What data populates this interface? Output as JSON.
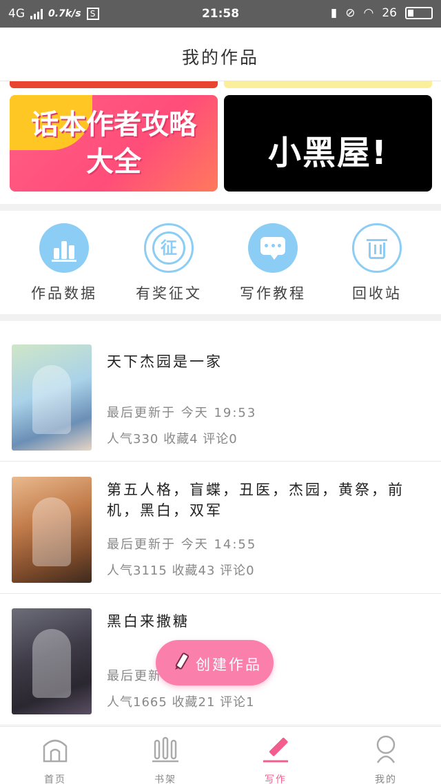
{
  "status_bar": {
    "network": "4G",
    "speed": "0.7k/s",
    "sim_icon": "S",
    "time": "21:58",
    "battery_pct": "26"
  },
  "header": {
    "title": "我的作品"
  },
  "banners": [
    {
      "text_line1": "话本作者攻略",
      "text_line2": "大全",
      "bg": "#ff4d79"
    },
    {
      "text": "小黑屋!",
      "bg": "#000000"
    }
  ],
  "shortcuts": [
    {
      "label": "作品数据",
      "icon": "bar-chart-icon"
    },
    {
      "label": "有奖征文",
      "icon": "contest-icon",
      "glyph": "征"
    },
    {
      "label": "写作教程",
      "icon": "message-icon"
    },
    {
      "label": "回收站",
      "icon": "trash-icon"
    }
  ],
  "works": [
    {
      "title": "天下杰园是一家",
      "updated": "最后更新于 今天 19:53",
      "stats": "人气330 收藏4 评论0"
    },
    {
      "title": "第五人格，盲蝶，丑医，杰园，黄祭，前机，黑白，双军",
      "updated": "最后更新于 今天 14:55",
      "stats": "人气3115 收藏43 评论0"
    },
    {
      "title": "黑白来撒糖",
      "updated": "最后更新于 今天",
      "stats": "人气1665 收藏21 评论1"
    }
  ],
  "fab": {
    "label": "创建作品"
  },
  "bottom_nav": [
    {
      "label": "首页",
      "icon": "home-icon",
      "active": false
    },
    {
      "label": "书架",
      "icon": "bookshelf-icon",
      "active": false
    },
    {
      "label": "写作",
      "icon": "pencil-icon",
      "active": true
    },
    {
      "label": "我的",
      "icon": "profile-icon",
      "active": false
    }
  ],
  "colors": {
    "accent": "#f35d8e",
    "icon_blue": "#8ccdf5",
    "fab_pink": "#fa7fab"
  }
}
